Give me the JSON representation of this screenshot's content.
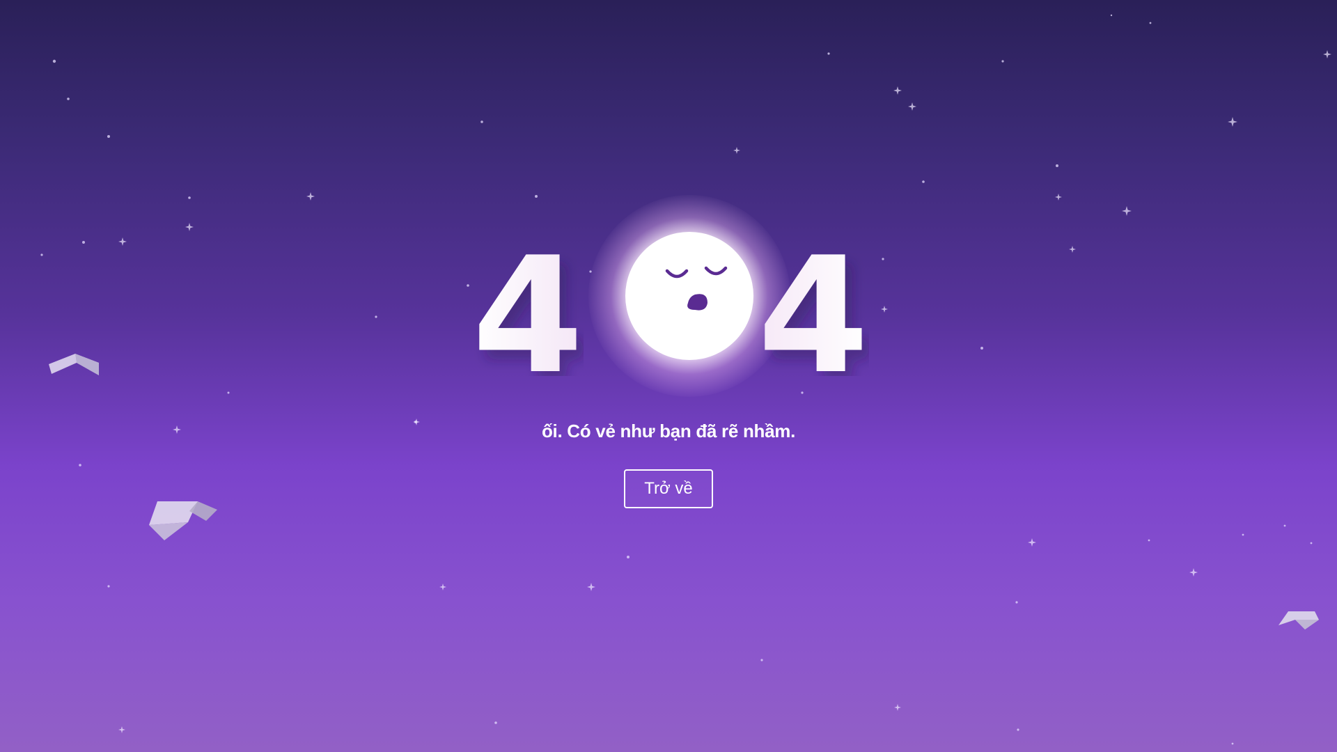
{
  "error": {
    "code_first": "4",
    "code_last": "4",
    "message": "ối. Có vẻ như bạn đã rẽ nhầm.",
    "back_label": "Trở về"
  },
  "colors": {
    "background_top": "#2a2058",
    "background_middle": "#7b43cb",
    "background_bottom": "#9260c6",
    "moon": "#ffffff",
    "moon_features": "#5a2b92",
    "text": "#ffffff"
  },
  "icons": [
    "sleeping-moon-icon",
    "sparkle-star-icon",
    "paper-shard-icon"
  ]
}
